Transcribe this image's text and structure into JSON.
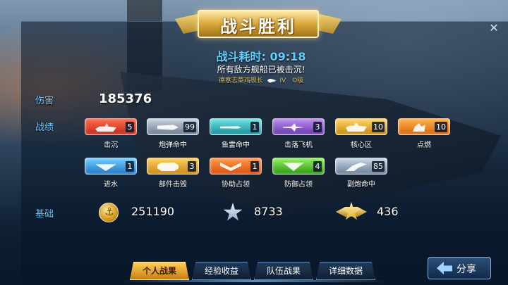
{
  "banner": {
    "title": "战斗胜利"
  },
  "battle": {
    "duration_label": "战斗耗时: 09:18",
    "message": "所有敌方舰船已被击沉!",
    "player_name": "德意志菜鸡舰长",
    "player_tier": "IV",
    "player_grade": "O级"
  },
  "labels": {
    "damage": "伤害",
    "record": "战绩",
    "base": "基础"
  },
  "damage_value": "185376",
  "stats_row1": [
    {
      "name": "击沉",
      "count": "5"
    },
    {
      "name": "炮弹命中",
      "count": "99"
    },
    {
      "name": "鱼雷命中",
      "count": "1"
    },
    {
      "name": "击落飞机",
      "count": "3"
    },
    {
      "name": "核心区",
      "count": "10"
    },
    {
      "name": "点燃",
      "count": "10"
    }
  ],
  "stats_row2": [
    {
      "name": "进水",
      "count": "1"
    },
    {
      "name": "部件击毁",
      "count": "3"
    },
    {
      "name": "协助占领",
      "count": "1"
    },
    {
      "name": "防御占领",
      "count": "4"
    },
    {
      "name": "副炮命中",
      "count": "85"
    }
  ],
  "resources": {
    "credits": "251190",
    "exp": "8733",
    "free_exp": "436"
  },
  "tabs": [
    "个人战果",
    "经验收益",
    "队伍战果",
    "详细数据"
  ],
  "share_label": "分享",
  "close_label": "✕",
  "colors": {
    "accent_blue": "#5fd1ff",
    "gold": "#d9a83a"
  }
}
